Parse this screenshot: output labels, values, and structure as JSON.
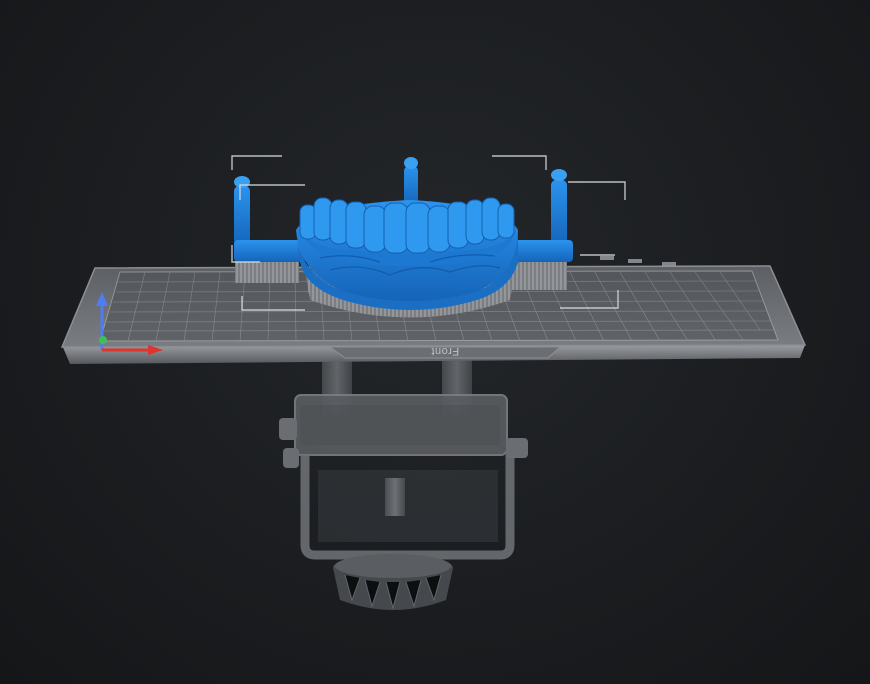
{
  "viewport": {
    "background": "#17191b",
    "build_plate": {
      "front_label": "Front",
      "plate_color": "#6f7276",
      "grid_color": "#8d9196"
    },
    "model": {
      "color": "#1f7fd6"
    },
    "axes_gizmo": {
      "x_color": "#e0342f",
      "y_color": "#3fbf5a",
      "z_color": "#4f7cf0"
    },
    "icons": {
      "axes": "axes-gizmo-icon"
    }
  }
}
